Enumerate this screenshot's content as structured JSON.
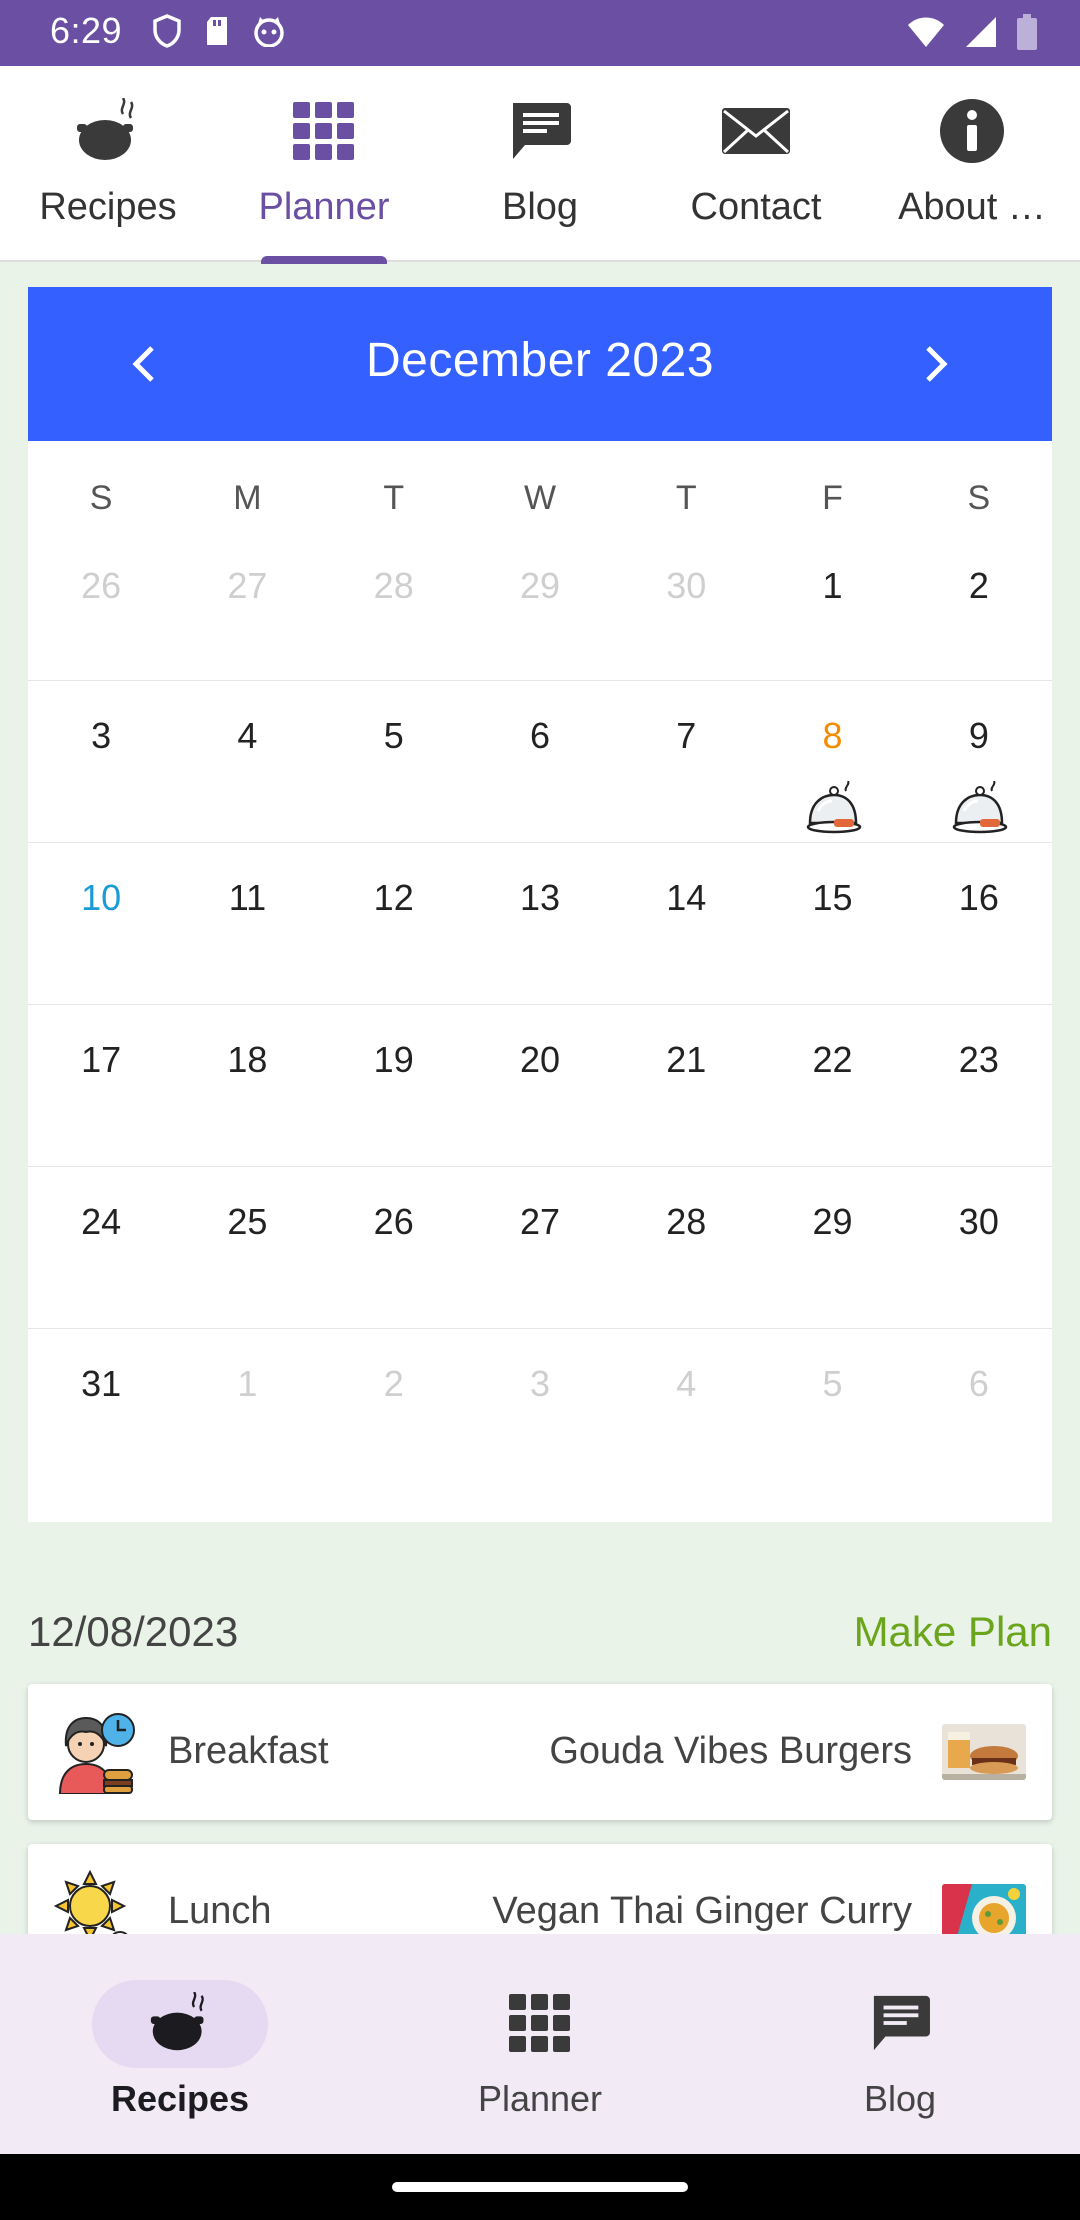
{
  "status_bar": {
    "time": "6:29",
    "icons_left": [
      "shield-icon",
      "sd-card-icon",
      "cat-face-icon"
    ],
    "icons_right": [
      "wifi-icon",
      "signal-icon",
      "battery-icon"
    ]
  },
  "top_tabs": [
    {
      "label": "Recipes",
      "icon": "pot-icon",
      "active": false
    },
    {
      "label": "Planner",
      "icon": "grid-icon",
      "active": true
    },
    {
      "label": "Blog",
      "icon": "chat-icon",
      "active": false
    },
    {
      "label": "Contact",
      "icon": "envelope-icon",
      "active": false
    },
    {
      "label": "About …",
      "icon": "info-icon",
      "active": false
    }
  ],
  "calendar": {
    "title": "December  2023",
    "weekdays": [
      "S",
      "M",
      "T",
      "W",
      "T",
      "F",
      "S"
    ],
    "weeks": [
      [
        "26",
        "27",
        "28",
        "29",
        "30",
        "1",
        "2"
      ],
      [
        "3",
        "4",
        "5",
        "6",
        "7",
        "8",
        "9"
      ],
      [
        "10",
        "11",
        "12",
        "13",
        "14",
        "15",
        "16"
      ],
      [
        "17",
        "18",
        "19",
        "20",
        "21",
        "22",
        "23"
      ],
      [
        "24",
        "25",
        "26",
        "27",
        "28",
        "29",
        "30"
      ],
      [
        "31",
        "1",
        "2",
        "3",
        "4",
        "5",
        "6"
      ]
    ],
    "selected_day": "8",
    "today": "10",
    "days_with_meals": [
      "8",
      "9"
    ]
  },
  "plan": {
    "date": "12/08/2023",
    "make_plan_label": "Make Plan",
    "meals": [
      {
        "type": "Breakfast",
        "recipe": "Gouda Vibes Burgers",
        "avatar": "person-clock-icon",
        "thumb": "burger-photo"
      },
      {
        "type": "Lunch",
        "recipe": "Vegan Thai Ginger Curry",
        "avatar": "sun-icon",
        "thumb": "curry-photo"
      }
    ]
  },
  "bottom_nav": [
    {
      "label": "Recipes",
      "icon": "pot-icon",
      "active": true
    },
    {
      "label": "Planner",
      "icon": "grid-icon",
      "active": false
    },
    {
      "label": "Blog",
      "icon": "chat-icon",
      "active": false
    }
  ],
  "colors": {
    "brand_purple": "#6a4fa3",
    "calendar_header": "#3360ff",
    "selected_day": "#f28c00",
    "today": "#1a9bd6",
    "make_plan": "#6aa51c",
    "background": "#e9f3e8"
  }
}
